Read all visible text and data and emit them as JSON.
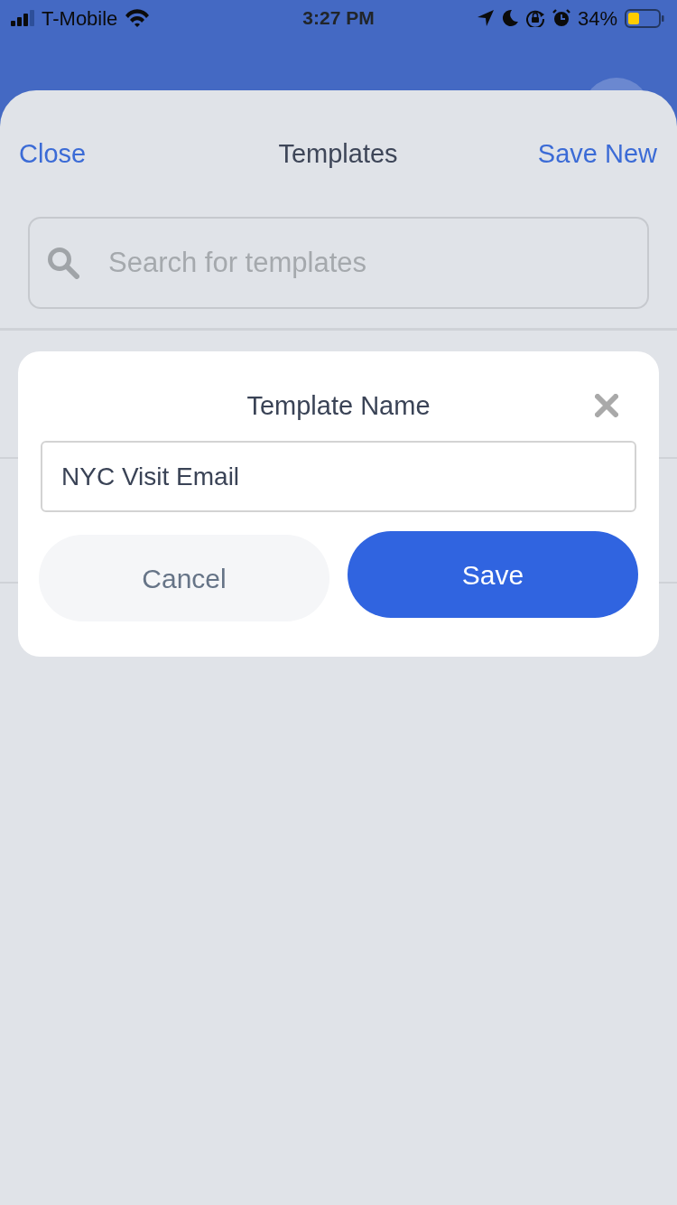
{
  "status_bar": {
    "carrier": "T-Mobile",
    "time": "3:27 PM",
    "battery": "34%"
  },
  "sheet": {
    "header": {
      "close": "Close",
      "title": "Templates",
      "action": "Save New"
    },
    "search": {
      "placeholder": "Search for templates"
    }
  },
  "dialog": {
    "title": "Template Name",
    "name_field": {
      "value": "NYC Visit Email"
    },
    "buttons": [
      {
        "label": "Cancel",
        "kind": "secondary"
      },
      {
        "label": "Save",
        "kind": "primary"
      }
    ]
  }
}
